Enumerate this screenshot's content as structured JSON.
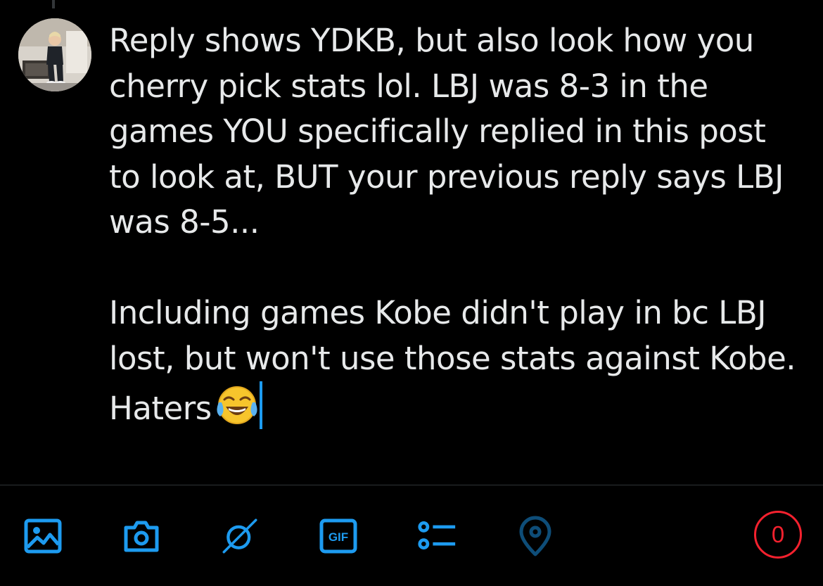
{
  "composer": {
    "paragraph_1": "Reply shows YDKB, but also look how you cherry pick stats lol. LBJ was 8-3 in the games YOU specifically replied in this post to look at, BUT your previous reply says LBJ was 8-5...",
    "paragraph_2": "Including games Kobe didn't play in bc LBJ lost, but won't use those stats against Kobe. Haters",
    "emoji": "face-with-tears-of-joy"
  },
  "toolbar": {
    "items": [
      {
        "icon": "image-icon"
      },
      {
        "icon": "camera-icon"
      },
      {
        "icon": "grok-icon"
      },
      {
        "icon": "gif-icon",
        "label": "GIF"
      },
      {
        "icon": "poll-icon"
      },
      {
        "icon": "location-icon"
      }
    ],
    "char_counter": "0"
  },
  "colors": {
    "background": "#000000",
    "text": "#e7e9ea",
    "accent": "#1d9bf0",
    "accent_disabled": "#0e4d78",
    "counter_over_limit": "#f4212e",
    "divider": "#2f3336"
  }
}
